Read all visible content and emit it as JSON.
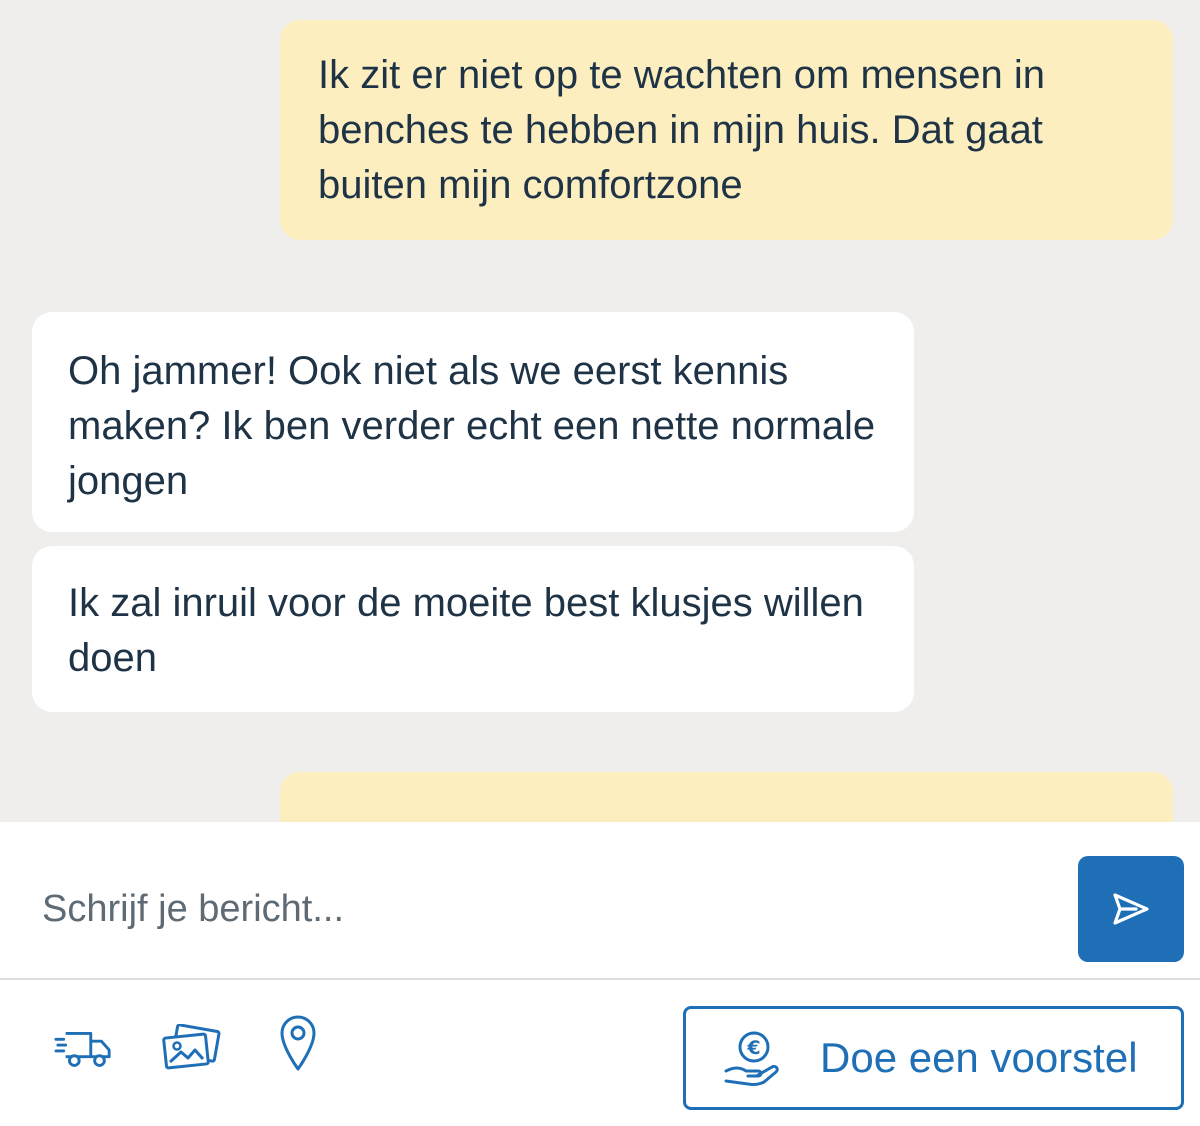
{
  "messages": [
    {
      "direction": "sent",
      "text": "Ik zit er niet op te wachten om mensen in benches te hebben in mijn huis. Dat gaat buiten mijn comfortzone"
    },
    {
      "direction": "received",
      "text": "Oh jammer! Ook niet als we eerst kennis maken? Ik ben verder echt een nette normale jongen"
    },
    {
      "direction": "received",
      "text": "Ik zal inruil voor de moeite best klusjes willen doen"
    },
    {
      "direction": "sent",
      "text": "",
      "partially_hidden": true
    }
  ],
  "composer": {
    "placeholder": "Schrijf je bericht...",
    "value": "",
    "send_icon": "send-icon"
  },
  "toolbar": {
    "icons": [
      "truck-icon",
      "photos-icon",
      "location-pin-icon"
    ],
    "offer_button": {
      "label": "Doe een voorstel",
      "icon": "euro-hand-icon"
    }
  },
  "colors": {
    "background": "#efeeec",
    "sent_bubble": "#fdeec0",
    "received_bubble": "#ffffff",
    "text": "#1f3346",
    "accent": "#1f6fb7"
  }
}
